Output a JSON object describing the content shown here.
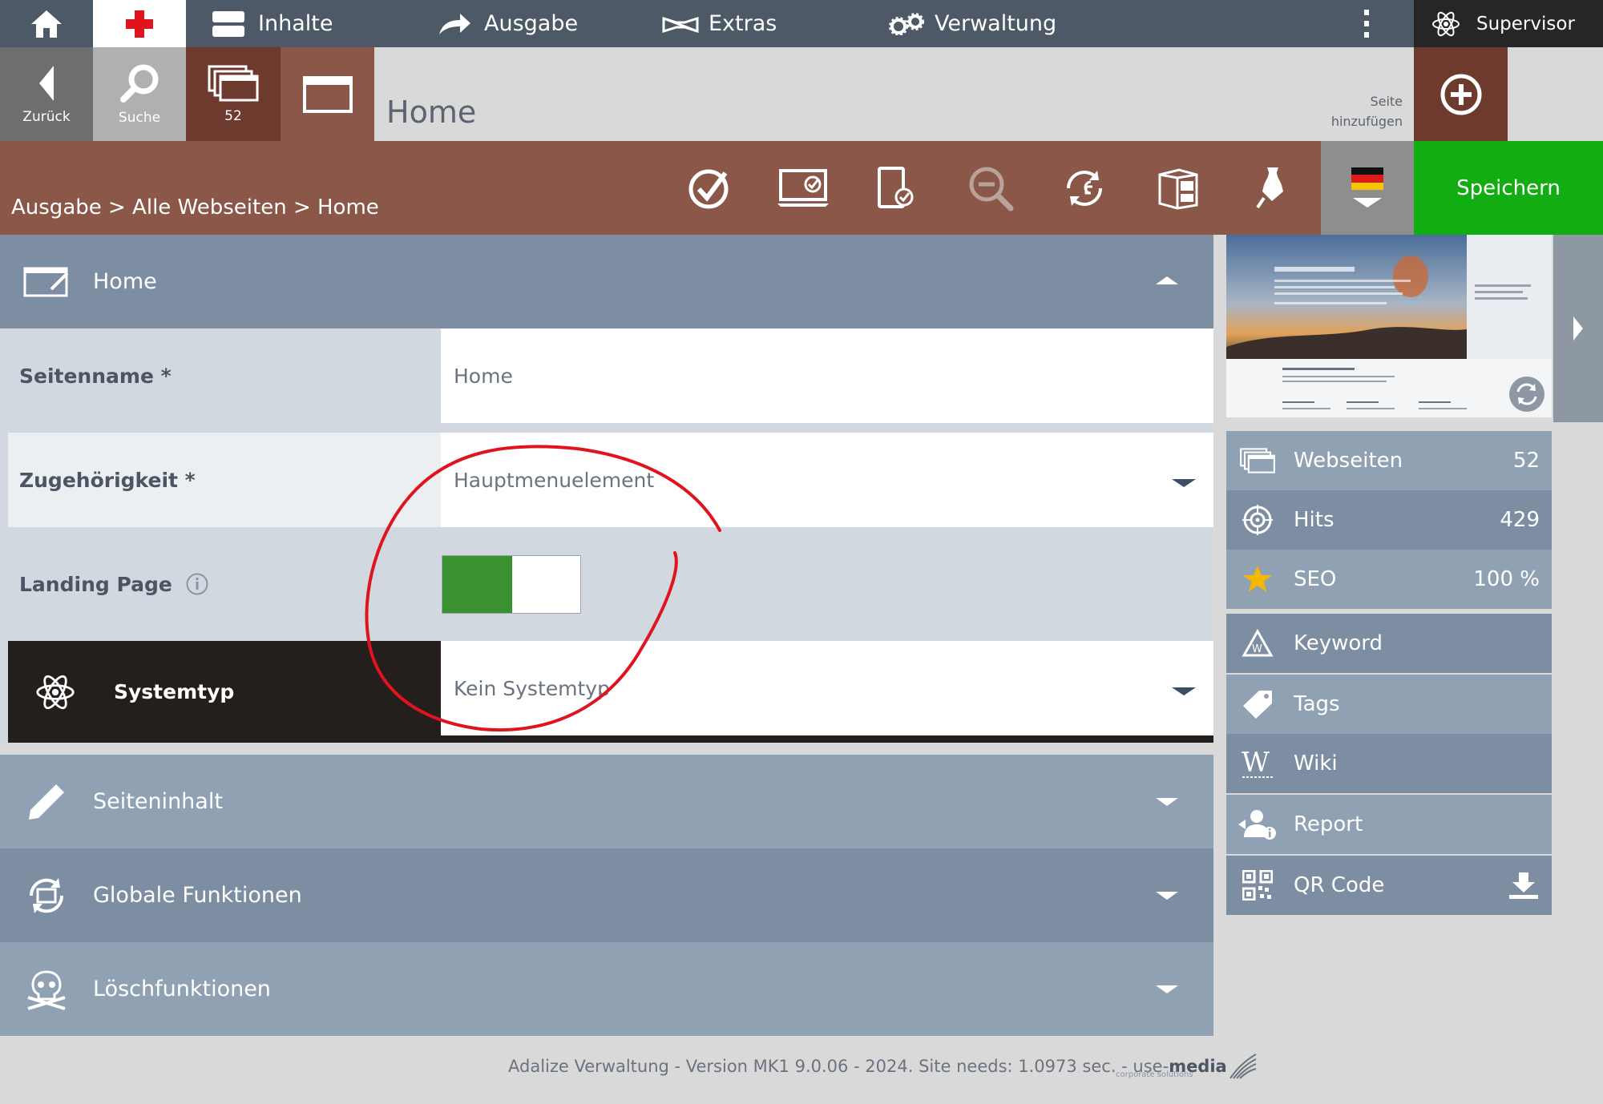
{
  "topnav": {
    "items": [
      {
        "label": "Inhalte",
        "icon": "drawer-icon"
      },
      {
        "label": "Ausgabe",
        "icon": "arrow-forward-icon"
      },
      {
        "label": "Extras",
        "icon": "extras-icon"
      },
      {
        "label": "Verwaltung",
        "icon": "gears-icon"
      }
    ],
    "user": "Supervisor"
  },
  "subnav": {
    "back_label": "Zurück",
    "search_label": "Suche",
    "pages_count": "52",
    "page_title": "Home",
    "add_page_label_1": "Seite",
    "add_page_label_2": "hinzufügen"
  },
  "breadcrumb": "Ausgabe > Alle Webseiten > Home",
  "save_label": "Speichern",
  "colors": {
    "nav_bg": "#4d5966",
    "brown": "#8a5748",
    "dark_brown": "#6e3a2d",
    "save_green": "#12ad12",
    "toggle_green": "#3a9130",
    "panel_head": "#7d8ea3",
    "panel_head_light": "#91a1b4",
    "annotation_red": "#e0141e"
  },
  "form": {
    "section_title": "Home",
    "fields": [
      {
        "label": "Seitenname *",
        "value": "Home"
      },
      {
        "label": "Zugehörigkeit *",
        "value": "Hauptmenuelement"
      },
      {
        "label": "Landing Page",
        "toggle": true
      },
      {
        "label": "Systemtyp",
        "value": "Kein Systemtyp"
      }
    ]
  },
  "sections": [
    "Seiteninhalt",
    "Globale Funktionen",
    "Löschfunktionen"
  ],
  "sidebar": {
    "stats": [
      {
        "label": "Webseiten",
        "value": "52"
      },
      {
        "label": "Hits",
        "value": "429"
      },
      {
        "label": "SEO",
        "value": "100 %"
      },
      {
        "label": "Keyword",
        "value": ""
      },
      {
        "label": "Tags",
        "value": ""
      },
      {
        "label": "Wiki",
        "value": ""
      },
      {
        "label": "Report",
        "value": ""
      },
      {
        "label": "QR Code",
        "value": ""
      }
    ]
  },
  "footer": {
    "text": "Adalize Verwaltung - Version MK1 9.0.06 - 2024. Site needs: 1.0973 sec. - use-",
    "brand": "media",
    "brand_sub": "corporate solutions"
  }
}
